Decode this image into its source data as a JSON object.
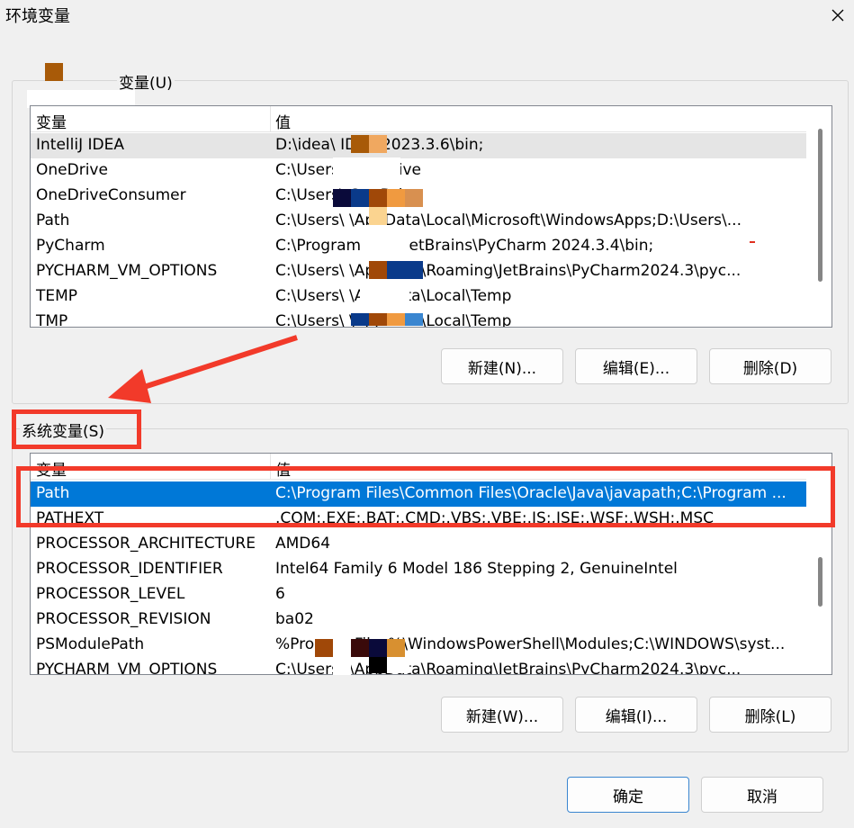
{
  "window": {
    "title": "环境变量",
    "close_icon": "close-icon"
  },
  "user_vars": {
    "legend": "变量(U)",
    "headers": {
      "name": "变量",
      "value": "值"
    },
    "rows": [
      {
        "name": "IntelliJ IDEA",
        "value": "D:\\idea\\  IDEA 2023.3.6\\bin;"
      },
      {
        "name": "OneDrive",
        "value": "C:\\Users\\  OneDrive"
      },
      {
        "name": "OneDriveConsumer",
        "value": "C:\\Users\\  OneDrive"
      },
      {
        "name": "Path",
        "value": "C:\\Users\\  \\AppData\\Local\\Microsoft\\WindowsApps;D:\\Users\\..."
      },
      {
        "name": "PyCharm",
        "value": "C:\\Program Files\\JetBrains\\PyCharm 2024.3.4\\bin;"
      },
      {
        "name": "PYCHARM_VM_OPTIONS",
        "value": "C:\\Users\\  \\AppData\\Roaming\\JetBrains\\PyCharm2024.3\\pyc..."
      },
      {
        "name": "TEMP",
        "value": "C:\\Users\\  \\AppData\\Local\\Temp"
      },
      {
        "name": "TMP",
        "value": "C:\\Users\\  \\AppData\\Local\\Temp"
      }
    ],
    "buttons": {
      "new": "新建(N)...",
      "edit": "编辑(E)...",
      "delete": "删除(D)"
    }
  },
  "system_vars": {
    "legend": "系统变量(S)",
    "headers": {
      "name": "变量",
      "value": "值"
    },
    "rows": [
      {
        "name": "Path",
        "value": "C:\\Program Files\\Common Files\\Oracle\\Java\\javapath;C:\\Program ..."
      },
      {
        "name": "PATHEXT",
        "value": ".COM;.EXE;.BAT;.CMD;.VBS;.VBE;.JS;.JSE;.WSF;.WSH;.MSC"
      },
      {
        "name": "PROCESSOR_ARCHITECTURE",
        "value": "AMD64"
      },
      {
        "name": "PROCESSOR_IDENTIFIER",
        "value": "Intel64 Family 6 Model 186 Stepping 2, GenuineIntel"
      },
      {
        "name": "PROCESSOR_LEVEL",
        "value": "6"
      },
      {
        "name": "PROCESSOR_REVISION",
        "value": "ba02"
      },
      {
        "name": "PSModulePath",
        "value": "%ProgramFiles%\\WindowsPowerShell\\Modules;C:\\WINDOWS\\syst..."
      },
      {
        "name": "PYCHARM_VM_OPTIONS",
        "value": "C:\\Users\\  \\AppData\\Roaming\\JetBrains\\PyCharm2024.3\\pyc..."
      }
    ],
    "buttons": {
      "new": "新建(W)...",
      "edit": "编辑(I)...",
      "delete": "删除(L)"
    }
  },
  "footer": {
    "ok": "确定",
    "cancel": "取消"
  },
  "annotation_color": "#f23a2a",
  "selection_color": "#0078d7"
}
